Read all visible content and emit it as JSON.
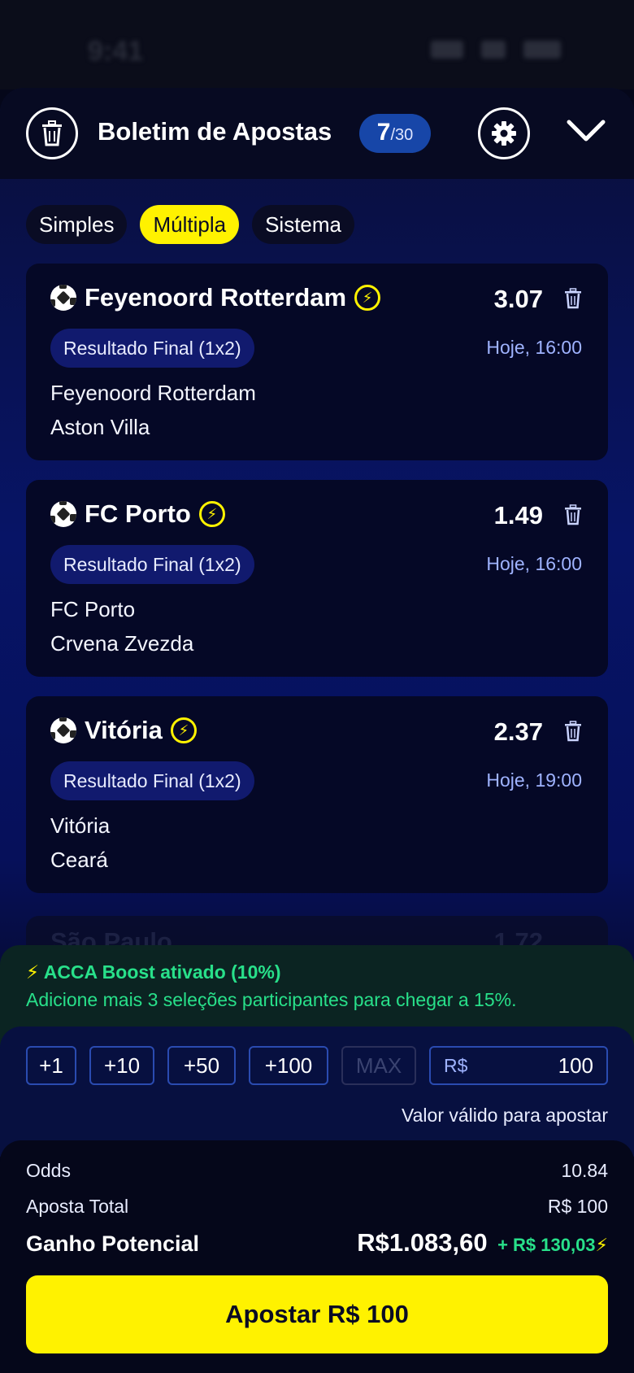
{
  "status_bar": {
    "time": "9:41"
  },
  "header": {
    "title": "Boletim de Apostas",
    "selection_count": "7",
    "selection_max": "/30"
  },
  "tabs": [
    {
      "label": "Simples",
      "active": false
    },
    {
      "label": "Múltipla",
      "active": true
    },
    {
      "label": "Sistema",
      "active": false
    }
  ],
  "bets": [
    {
      "event": "Feyenoord Rotterdam",
      "odds": "3.07",
      "market": "Resultado Final (1x2)",
      "time": "Hoje, 16:00",
      "home": "Feyenoord Rotterdam",
      "away": "Aston Villa"
    },
    {
      "event": "FC Porto",
      "odds": "1.49",
      "market": "Resultado Final (1x2)",
      "time": "Hoje, 16:00",
      "home": "FC Porto",
      "away": "Crvena Zvezda"
    },
    {
      "event": "Vitória",
      "odds": "2.37",
      "market": "Resultado Final (1x2)",
      "time": "Hoje, 19:00",
      "home": "Vitória",
      "away": "Ceará"
    },
    {
      "event": "São Paulo",
      "odds": "1.72"
    }
  ],
  "boost": {
    "title": "ACCA Boost ativado (10%)",
    "message": "Adicione mais 3 seleções participantes para chegar a 15%."
  },
  "stake": {
    "quick_amounts": [
      "+1",
      "+10",
      "+50",
      "+100",
      "MAX"
    ],
    "currency": "R$",
    "amount": "100",
    "valid_note": "Valor válido para apostar"
  },
  "summary": {
    "odds_label": "Odds",
    "odds_value": "10.84",
    "total_label": "Aposta Total",
    "total_value": "R$ 100",
    "potential_label": "Ganho Potencial",
    "potential_value": "R$1.083,60",
    "boost_gain": "+ R$ 130,03"
  },
  "place_button": {
    "label": "Apostar R$ 100"
  },
  "colors": {
    "accent": "#fff200",
    "boost": "#28e08a",
    "badge": "#1746a8"
  }
}
